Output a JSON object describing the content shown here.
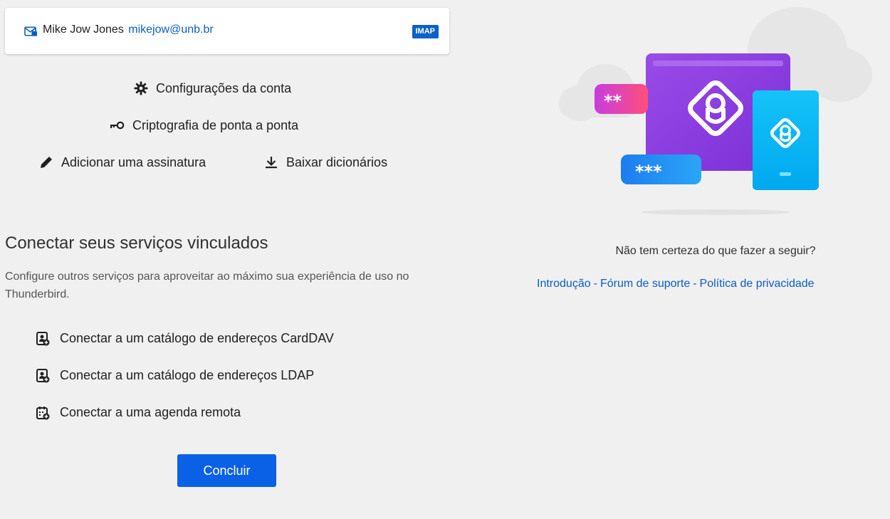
{
  "account": {
    "name": "Mike Jow Jones",
    "email": "mikejow@unb.br",
    "protocol": "IMAP",
    "icon": "mail-account-icon"
  },
  "actions": {
    "settings": {
      "label": "Configurações da conta",
      "icon": "gear-icon"
    },
    "e2ee": {
      "label": "Criptografia de ponta a ponta",
      "icon": "key-icon"
    },
    "signature": {
      "label": "Adicionar uma assinatura",
      "icon": "pencil-icon"
    },
    "dictionaries": {
      "label": "Baixar dicionários",
      "icon": "download-icon"
    }
  },
  "services": {
    "title": "Conectar seus serviços vinculados",
    "description": "Configure outros serviços para aproveitar ao máximo sua experiência de uso no Thunderbird.",
    "items": [
      {
        "label": "Conectar a um catálogo de endereços CardDAV",
        "icon": "address-book-add-icon"
      },
      {
        "label": "Conectar a um catálogo de endereços LDAP",
        "icon": "address-book-add-icon"
      },
      {
        "label": "Conectar a uma agenda remota",
        "icon": "calendar-add-icon"
      }
    ]
  },
  "finish_button": "Concluir",
  "help": {
    "question": "Não tem certeza do que fazer a seguir?",
    "links": [
      "Introdução",
      "Fórum de suporte",
      "Política de privacidade"
    ],
    "separator": "-"
  },
  "illustration": {
    "password_mask_short": "**",
    "password_mask_long": "***"
  },
  "colors": {
    "accent": "#0a61e5",
    "link": "#0a5dc2",
    "purple": "#8e3ee4",
    "cyan": "#00b3f4"
  }
}
